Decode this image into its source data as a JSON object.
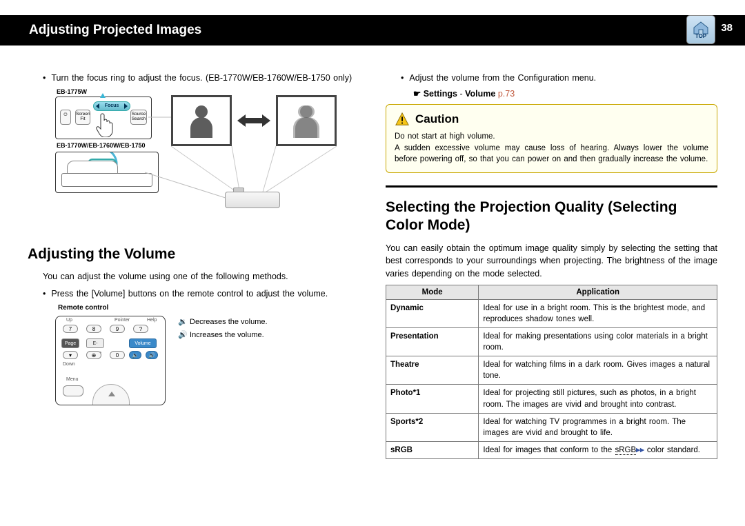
{
  "header": {
    "title": "Adjusting Projected Images",
    "page": "38",
    "top_label": "TOP"
  },
  "left": {
    "focus_bullet": "Turn the focus ring to adjust the focus. (EB-1770W/EB-1760W/EB-1750 only)",
    "dev1_label": "EB-1775W",
    "panel": {
      "power": "⏻",
      "screenfit": "Screen Fit",
      "focus": "Focus",
      "source": "Source Search"
    },
    "dev2_label": "EB-1770W/EB-1760W/EB-1750",
    "section_volume": "Adjusting the Volume",
    "volume_intro": "You can adjust the volume using one of the following methods.",
    "volume_bullet": "Press the [Volume] buttons on the remote control to adjust the volume.",
    "remote_label": "Remote control",
    "remote": {
      "up": "Up",
      "down": "Down",
      "pointer": "Pointer",
      "help": "Help",
      "page": "Page",
      "ezoom": "E-Zoom",
      "volume": "Volume",
      "menu": "Menu",
      "k7": "7",
      "k8": "8",
      "k9": "9",
      "kq": "?",
      "k0": "0"
    },
    "legend_dec": " Decreases the volume.",
    "legend_inc": " Increases the volume."
  },
  "right": {
    "config_bullet": "Adjust the volume from the Configuration menu.",
    "settings_lead": "Settings",
    "settings_dash": " - ",
    "settings_item": "Volume",
    "settings_page": "p.73",
    "caution_title": "Caution",
    "caution_line1": "Do not start at high volume.",
    "caution_line2": "A sudden excessive volume may cause loss of hearing. Always lower the volume before powering off, so that you can power on and then gradually increase the volume.",
    "section_quality": "Selecting the Projection Quality (Selecting Color Mode)",
    "quality_intro": "You can easily obtain the optimum image quality simply by selecting the setting that best corresponds to your surroundings when projecting. The brightness of the image varies depending on the mode selected.",
    "table": {
      "head_mode": "Mode",
      "head_app": "Application",
      "rows": [
        {
          "mode": "Dynamic",
          "app": "Ideal for use in a bright room. This is the brightest mode, and reproduces shadow tones well."
        },
        {
          "mode": "Presentation",
          "app": "Ideal for making presentations using color materials in a bright room."
        },
        {
          "mode": "Theatre",
          "app": "Ideal for watching films in a dark room. Gives images a natural tone."
        },
        {
          "mode": "Photo*1",
          "app": "Ideal for projecting still pictures, such as photos, in a bright room. The images are vivid and brought into contrast."
        },
        {
          "mode": "Sports*2",
          "app": "Ideal for watching TV programmes in a bright room. The images are vivid and brought to life."
        },
        {
          "mode": "sRGB",
          "app_pre": "Ideal for images that conform to the ",
          "app_link": "sRGB",
          "app_post": " color standard."
        }
      ]
    }
  }
}
